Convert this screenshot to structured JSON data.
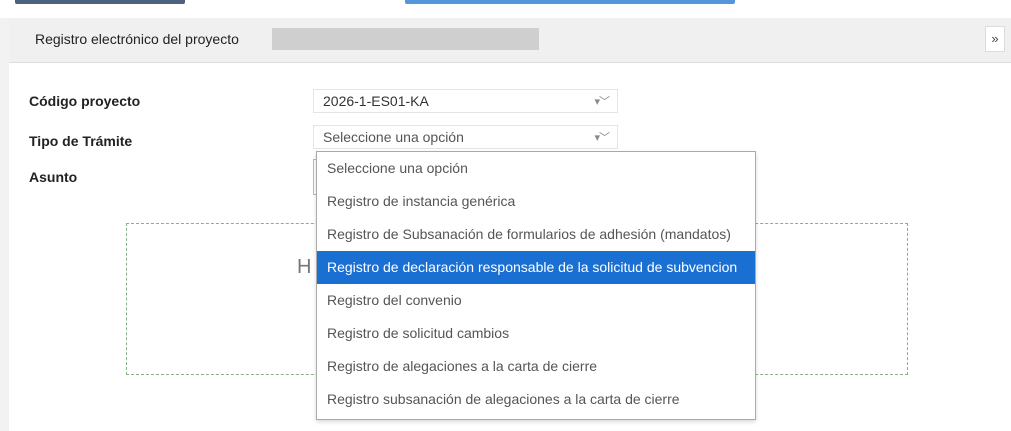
{
  "dialog": {
    "title": "Registro electrónico del proyecto",
    "collapse_glyph": "»"
  },
  "form": {
    "codigo": {
      "label": "Código proyecto",
      "value": "2026-1-ES01-KA"
    },
    "tipo": {
      "label": "Tipo de Trámite",
      "value": "Seleccione una opción"
    },
    "asunto": {
      "label": "Asunto"
    }
  },
  "dropzone": {
    "partial_text": "H"
  },
  "dropdown": {
    "selected_index": 3,
    "options": [
      "Seleccione una opción",
      "Registro de instancia genérica",
      "Registro de Subsanación de formularios de adhesión (mandatos)",
      "Registro de declaración responsable de la solicitud de subvencion",
      "Registro del convenio",
      "Registro de solicitud cambios",
      "Registro de alegaciones a la carta de cierre",
      "Registro subsanación de alegaciones a la carta de cierre"
    ]
  },
  "icons": {
    "select_arrow": "dropdown-arrows-icon",
    "collapse": "double-chevron-right-icon"
  },
  "colors": {
    "selected_bg": "#1a6fd2",
    "header_bg": "#f0f0f0",
    "dropzone_border": "#8ab08a"
  }
}
